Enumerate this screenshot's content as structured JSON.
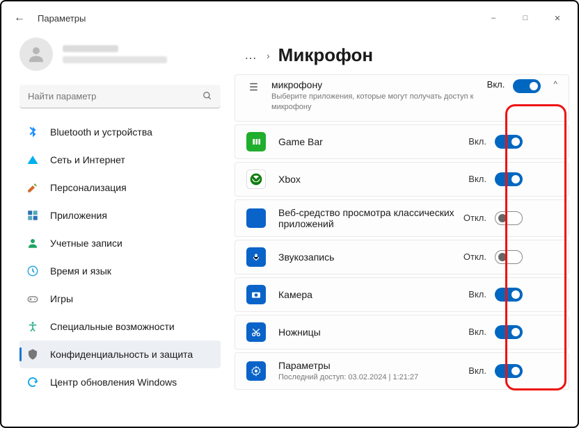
{
  "window": {
    "title": "Параметры"
  },
  "search": {
    "placeholder": "Найти параметр"
  },
  "nav": [
    {
      "key": "bluetooth",
      "label": "Bluetooth и устройства",
      "color": "#1e90ff"
    },
    {
      "key": "network",
      "label": "Сеть и Интернет",
      "color": "#00b0f0"
    },
    {
      "key": "personalization",
      "label": "Персонализация",
      "color": "#d06a2c"
    },
    {
      "key": "apps",
      "label": "Приложения",
      "color": "#2b6fb3"
    },
    {
      "key": "accounts",
      "label": "Учетные записи",
      "color": "#1fa463"
    },
    {
      "key": "time",
      "label": "Время и язык",
      "color": "#2aa9e0"
    },
    {
      "key": "gaming",
      "label": "Игры",
      "color": "#888"
    },
    {
      "key": "accessibility",
      "label": "Специальные возможности",
      "color": "#2a8"
    },
    {
      "key": "privacy",
      "label": "Конфиденциальность и защита",
      "color": "#777",
      "active": true
    },
    {
      "key": "update",
      "label": "Центр обновления Windows",
      "color": "#0ea5e9"
    }
  ],
  "breadcrumb": {
    "page": "Микрофон"
  },
  "header_card": {
    "title": "микрофону",
    "sub": "Выберите приложения, которые могут получать доступ к микрофону",
    "state": "Вкл."
  },
  "apps": [
    {
      "key": "gamebar",
      "label": "Game Bar",
      "state": "Вкл.",
      "on": true,
      "bg": "#1fae2d"
    },
    {
      "key": "xbox",
      "label": "Xbox",
      "state": "Вкл.",
      "on": true,
      "bg": "#107c10"
    },
    {
      "key": "webviewer",
      "label": "Веб-средство просмотра классических приложений",
      "state": "Откл.",
      "on": false,
      "bg": "#0a63c9"
    },
    {
      "key": "voicerec",
      "label": "Звукозапись",
      "state": "Откл.",
      "on": false,
      "bg": "#0a63c9"
    },
    {
      "key": "camera",
      "label": "Камера",
      "state": "Вкл.",
      "on": true,
      "bg": "#0a63c9"
    },
    {
      "key": "snip",
      "label": "Ножницы",
      "state": "Вкл.",
      "on": true,
      "bg": "#0a63c9"
    },
    {
      "key": "settings",
      "label": "Параметры",
      "sub": "Последний доступ: 03.02.2024 | 1:21:27",
      "state": "Вкл.",
      "on": true,
      "bg": "#0a63c9"
    }
  ]
}
